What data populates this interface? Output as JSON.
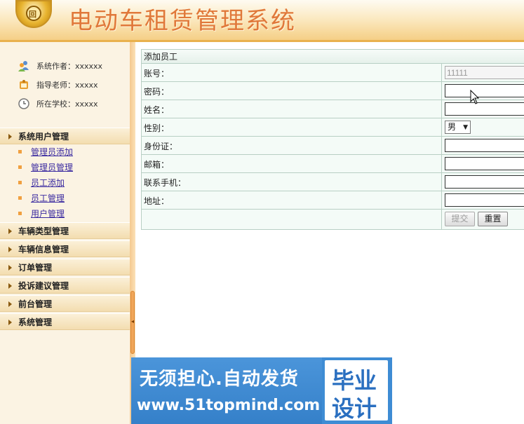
{
  "header": {
    "title": "电动车租赁管理系统",
    "logo_text": "回"
  },
  "sidebar": {
    "info": [
      {
        "label": "系统作者：xxxxxx",
        "icon": "users-icon"
      },
      {
        "label": "指导老师：xxxxx",
        "icon": "teacher-icon"
      },
      {
        "label": "所在学校：xxxxx",
        "icon": "clock-icon"
      }
    ],
    "menus": [
      {
        "label": "系统用户管理",
        "items": [
          "管理员添加",
          "管理员管理",
          "员工添加",
          "员工管理",
          "用户管理"
        ]
      },
      {
        "label": "车辆类型管理"
      },
      {
        "label": "车辆信息管理"
      },
      {
        "label": "订单管理"
      },
      {
        "label": "投诉建议管理"
      },
      {
        "label": "前台管理"
      },
      {
        "label": "系统管理"
      }
    ],
    "collapse_glyph": "◂"
  },
  "form": {
    "title": "添加员工",
    "fields": [
      {
        "label": "账号：",
        "value": "11111"
      },
      {
        "label": "密码：",
        "value": ""
      },
      {
        "label": "姓名：",
        "value": ""
      },
      {
        "label": "性别：",
        "value": "男"
      },
      {
        "label": "身份证：",
        "value": ""
      },
      {
        "label": "邮箱：",
        "value": ""
      },
      {
        "label": "联系手机：",
        "value": ""
      },
      {
        "label": "地址：",
        "value": ""
      }
    ],
    "submit_label": "提交",
    "reset_label": "重置",
    "select_caret": "▼"
  },
  "watermark": {
    "line1": "无须担心.自动发货",
    "line2": "www.51topmind.com",
    "badge_line1": "毕业",
    "badge_line2": "设计"
  },
  "colors": {
    "header_title": "#e0783a",
    "menu_link": "#3a2aa0",
    "watermark_blue": "#3e8cd4",
    "form_border": "#b8cfc4"
  }
}
